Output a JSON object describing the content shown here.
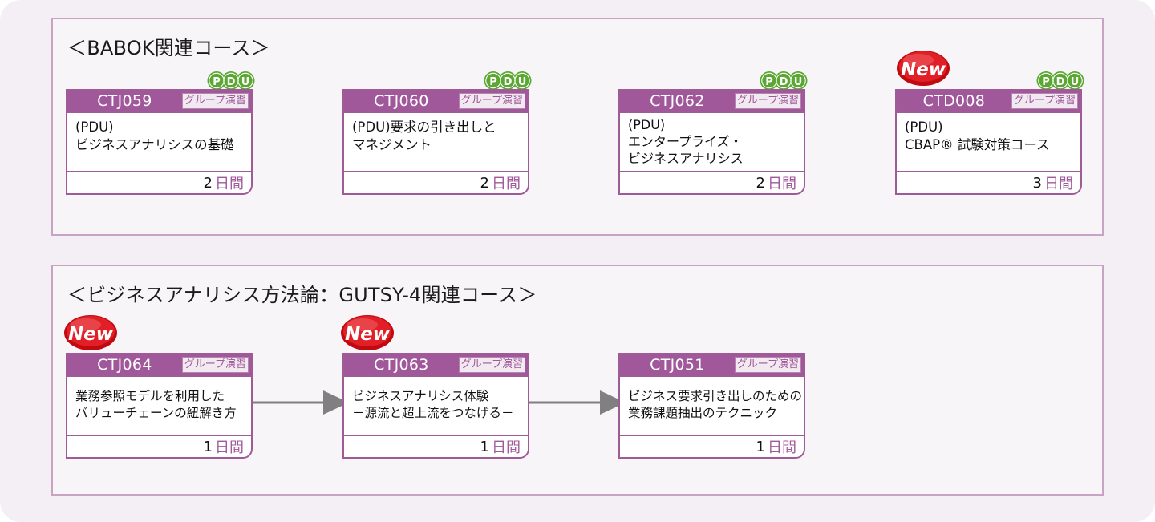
{
  "page": {
    "background_color": "#f4eff4",
    "panel_color": "#f8f5f8",
    "border_color": "#c9a3c4",
    "accent_purple": "#a0589a",
    "pdu_green": "#5aa832",
    "new_red": "#d81118",
    "arrow_gray": "#808080"
  },
  "sections": [
    {
      "id": "babok",
      "title": "＜BABOK関連コース＞",
      "cards": [
        {
          "code": "CTJ059",
          "tag": "グループ演習",
          "lines": [
            "(PDU)",
            "ビジネスアナリシスの基礎"
          ],
          "days_num": "2",
          "days_unit": "日間",
          "pdu": true,
          "new": false
        },
        {
          "code": "CTJ060",
          "tag": "グループ演習",
          "lines": [
            "(PDU)要求の引き出しと",
            "マネジメント"
          ],
          "days_num": "2",
          "days_unit": "日間",
          "pdu": true,
          "new": false
        },
        {
          "code": "CTJ062",
          "tag": "グループ演習",
          "lines": [
            "(PDU)",
            "エンタープライズ・",
            "ビジネスアナリシス"
          ],
          "days_num": "2",
          "days_unit": "日間",
          "pdu": true,
          "new": false
        },
        {
          "code": "CTD008",
          "tag": "グループ演習",
          "lines": [
            "(PDU)",
            "CBAP® 試験対策コース"
          ],
          "days_num": "3",
          "days_unit": "日間",
          "pdu": true,
          "new": true
        }
      ]
    },
    {
      "id": "gutsy",
      "title": "＜ビジネスアナリシス方法論：GUTSY-4関連コース＞",
      "cards": [
        {
          "code": "CTJ064",
          "tag": "グループ演習",
          "lines": [
            "業務参照モデルを利用した",
            "バリューチェーンの紐解き方"
          ],
          "days_num": "1",
          "days_unit": "日間",
          "pdu": false,
          "new": true
        },
        {
          "code": "CTJ063",
          "tag": "グループ演習",
          "lines": [
            "ビジネスアナリシス体験",
            "－源流と超上流をつなげる－"
          ],
          "days_num": "1",
          "days_unit": "日間",
          "pdu": false,
          "new": true
        },
        {
          "code": "CTJ051",
          "tag": "グループ演習",
          "lines": [
            "ビジネス要求引き出しのための",
            "業務課題抽出のテクニック"
          ],
          "days_num": "1",
          "days_unit": "日間",
          "pdu": false,
          "new": false
        }
      ]
    }
  ],
  "badges": {
    "pdu_letters": [
      "P",
      "D",
      "U"
    ],
    "new_label": "New"
  }
}
